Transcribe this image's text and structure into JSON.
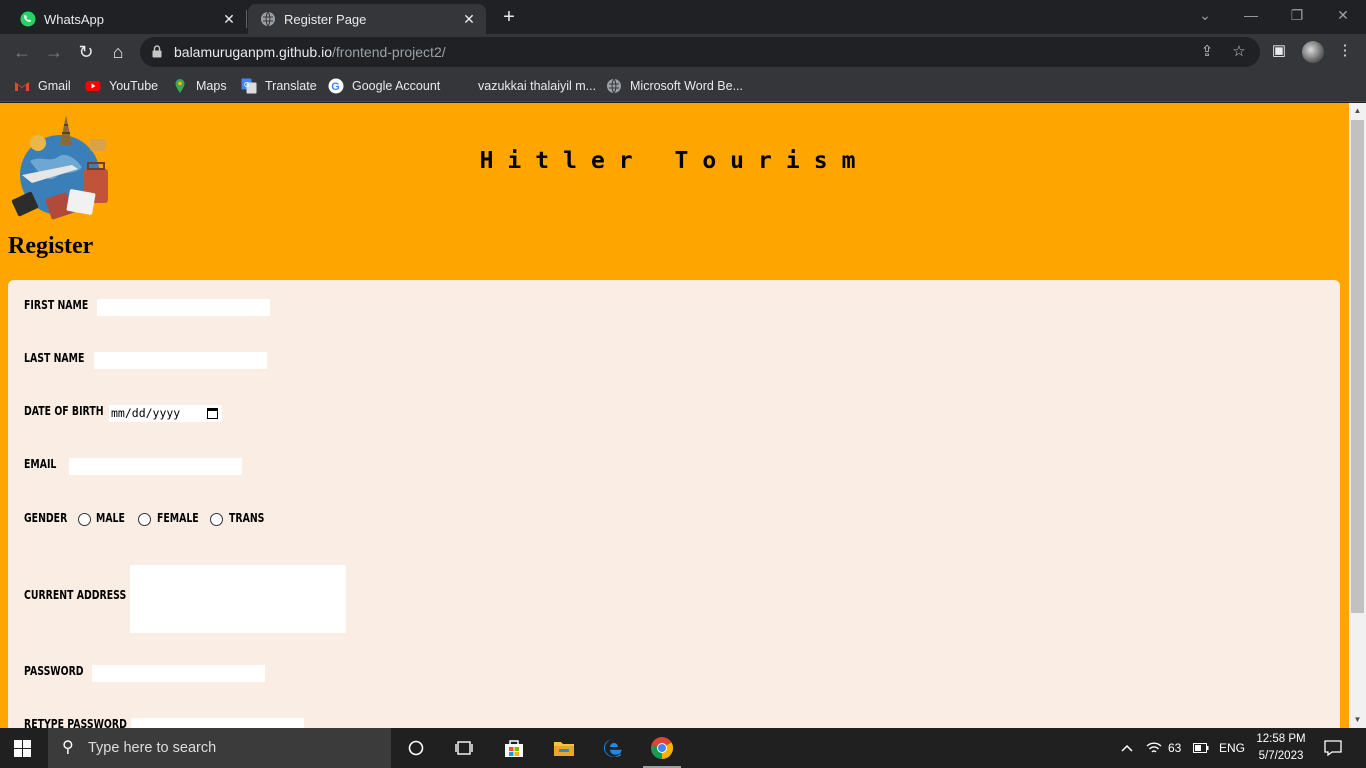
{
  "browser": {
    "tabs": [
      {
        "label": "WhatsApp",
        "icon": "whatsapp-icon",
        "active": false
      },
      {
        "label": "Register Page",
        "icon": "globe-icon",
        "active": true
      }
    ],
    "url_host": "balamuruganpm.github.io",
    "url_path": "/frontend-project2/",
    "bookmarks": [
      {
        "label": "Gmail",
        "icon": "gmail-icon"
      },
      {
        "label": "YouTube",
        "icon": "youtube-icon"
      },
      {
        "label": "Maps",
        "icon": "maps-icon"
      },
      {
        "label": "Translate",
        "icon": "translate-icon"
      },
      {
        "label": "Google Account",
        "icon": "google-icon"
      },
      {
        "label": "vazukkai thalaiyil m...",
        "icon": "none"
      },
      {
        "label": "Microsoft Word Be...",
        "icon": "globe-icon"
      }
    ]
  },
  "page": {
    "site_title": "Hitler Tourism",
    "heading": "Register",
    "background_color": "#ffa500",
    "form_background": "#faeee4",
    "form": {
      "first_name_label": "FIRST NAME",
      "first_name_value": "",
      "last_name_label": "LAST NAME",
      "last_name_value": "",
      "dob_label": "DATE OF BIRTH",
      "dob_placeholder": "mm/dd/yyyy",
      "email_label": "EMAIL",
      "email_value": "",
      "gender_label": "GENDER",
      "gender_options": [
        "MALE",
        "FEMALE",
        "TRANS"
      ],
      "address_label": "CURRENT ADDRESS",
      "address_value": "",
      "password_label": "PASSWORD",
      "password_value": "",
      "retype_password_label": "RETYPE PASSWORD"
    }
  },
  "taskbar": {
    "search_placeholder": "Type here to search",
    "tray": {
      "battery_level": "63",
      "language": "ENG",
      "time": "12:58 PM",
      "date": "5/7/2023"
    }
  }
}
